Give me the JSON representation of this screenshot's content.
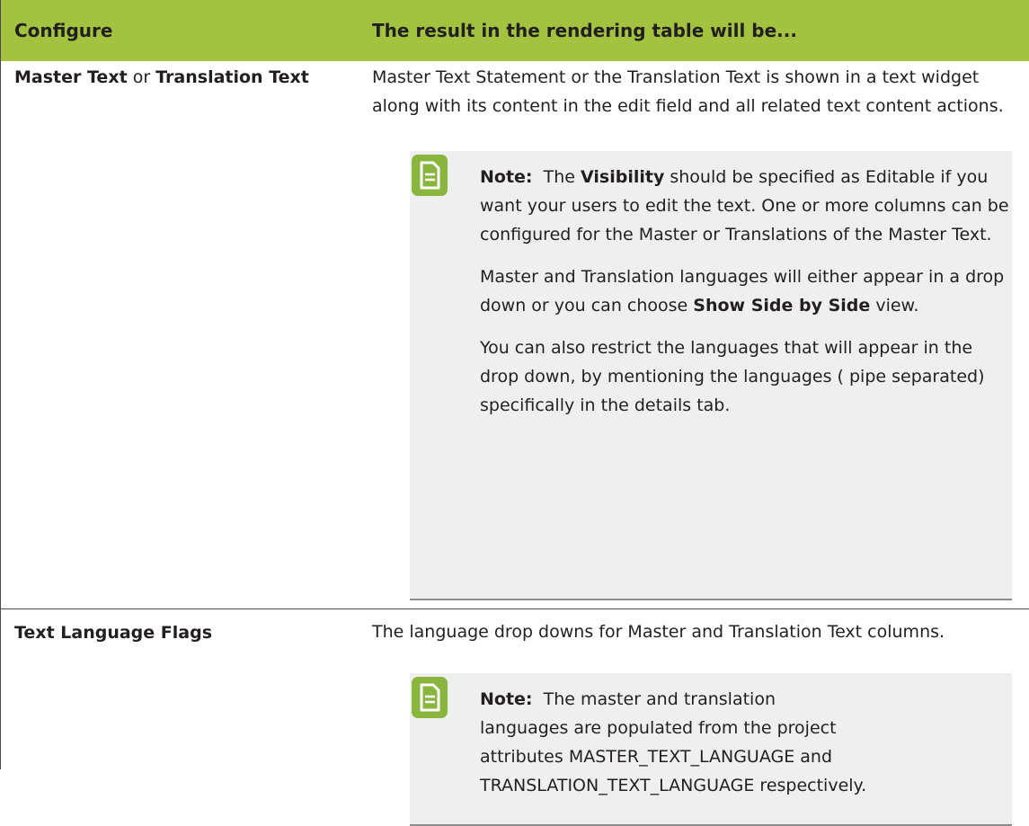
{
  "header": {
    "col1": "Configure",
    "col2": "The result in the rendering table will be..."
  },
  "rows": [
    {
      "label_bold_1": "Master Text",
      "label_sep": " or ",
      "label_bold_2": "Translation Text",
      "description": "Master Text Statement or the Translation Text is shown in a text widget along with its content in the edit field and all related text content actions.",
      "note": {
        "label": "Note:",
        "p1_a": "The ",
        "p1_bold": "Visibility",
        "p1_b": " should be specified as Editable if you want your users to edit the text. One or more columns can be configured for the Master or Translations of the Master Text.",
        "p2_a": "Master and Translation languages will either appear in a drop down or you can choose ",
        "p2_bold": "Show Side by Side",
        "p2_b": " view.",
        "p3": "You can also restrict the languages that will appear in the drop down, by mentioning the languages ( pipe separated) specifically in the details tab."
      }
    },
    {
      "label_bold_1": "Text Language Flags",
      "description": "The language drop downs for Master and Translation Text columns.",
      "note": {
        "label": "Note:",
        "p1_line1": "The master and translation",
        "p1_line2": "languages are populated from the project",
        "p1_line3": "attributes MASTER_TEXT_LANGUAGE and",
        "p1_line4": "TRANSLATION_TEXT_LANGUAGE respectively."
      }
    }
  ],
  "colors": {
    "header_bg": "#a3c23f",
    "note_bg": "#efefef",
    "note_icon": "#8ab640"
  },
  "icons": {
    "note": "note-document-icon"
  }
}
